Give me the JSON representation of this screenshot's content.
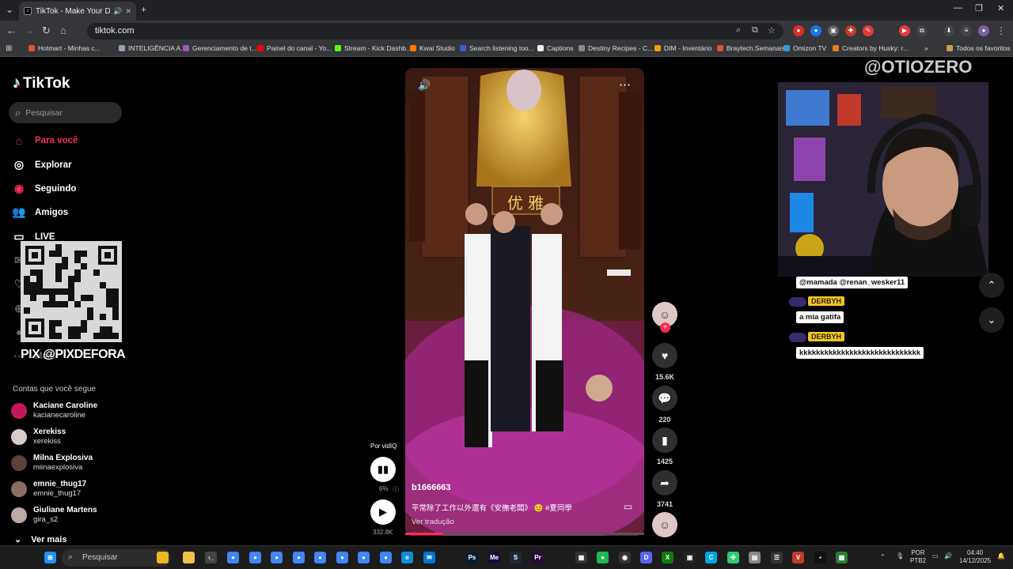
{
  "browser": {
    "tab_title": "TikTok - Make Your Day",
    "url": "tiktok.com",
    "bookmarks": [
      {
        "label": "Hotmart - Minhas c...",
        "color": "#e74c3c"
      },
      {
        "label": "INTELIGÊNCIA A...",
        "color": "#9aa0a6"
      },
      {
        "label": "Gerenciamento de t...",
        "color": "#9b59b6"
      },
      {
        "label": "Painel do canal - Yo...",
        "color": "#ff0000"
      },
      {
        "label": "Stream - Kick Dashb...",
        "color": "#53fc18"
      },
      {
        "label": "Kwai Studio",
        "color": "#ff7a00"
      },
      {
        "label": "Search listening too...",
        "color": "#3b5bdb"
      },
      {
        "label": "Captions",
        "color": "#eeeeee"
      },
      {
        "label": "Destiny Recipes - C...",
        "color": "#888888"
      },
      {
        "label": "DIM - Inventário",
        "color": "#f39c12"
      },
      {
        "label": "Braytech.Semanais",
        "color": "#e74c3c"
      },
      {
        "label": "Omizon TV",
        "color": "#3498db"
      },
      {
        "label": "Creators by Husky: r...",
        "color": "#e67e22"
      }
    ],
    "all_favorites": "Todos os favoritos"
  },
  "tiktok": {
    "logo": "TikTok",
    "search_placeholder": "Pesquisar",
    "nav": [
      {
        "label": "Para você",
        "icon": "home-icon"
      },
      {
        "label": "Explorar",
        "icon": "compass-icon"
      },
      {
        "label": "Seguindo",
        "icon": "following-icon"
      },
      {
        "label": "Amigos",
        "icon": "friends-icon"
      },
      {
        "label": "LIVE",
        "icon": "live-icon"
      },
      {
        "label": "Mensagens",
        "icon": "messages-icon"
      },
      {
        "label": "Atividade",
        "icon": "activity-icon"
      },
      {
        "label": "Carregar",
        "icon": "upload-icon"
      },
      {
        "label": "Perfil",
        "icon": "profile-icon"
      },
      {
        "label": "Mais",
        "icon": "more-icon"
      }
    ],
    "overlay_pix": "PIX @PIXDEFORA",
    "following_title": "Contas que você segue",
    "following": [
      {
        "name": "Kaciane Caroline",
        "username": "kacianecaroline",
        "color": "#c2185b"
      },
      {
        "name": "Xerekiss",
        "username": "xerekiss",
        "color": "#d7ccc8"
      },
      {
        "name": "Milna Explosiva",
        "username": "miinaexplosiva",
        "color": "#5d4037"
      },
      {
        "name": "emnie_thug17",
        "username": "emnie_thug17",
        "color": "#8d6e63"
      },
      {
        "name": "Giuliane Martens",
        "username": "gira_s2",
        "color": "#bcaaa4"
      }
    ],
    "ver_mais": "Ver mais",
    "video": {
      "author": "b1666663",
      "description": "平常除了工作以外還有《安撫老闆》 😊 #夏同學",
      "translate": "Ver tradução",
      "progress": 0.16
    },
    "actions": {
      "likes": "15.6K",
      "comments": "220",
      "saves": "1425",
      "shares": "3741"
    },
    "left_controls": {
      "by": "Por vidIQ",
      "percent": "6%",
      "views": "332.8K"
    }
  },
  "stream_overlay": {
    "handle": "@OTIOZERO",
    "chat": [
      {
        "user": "",
        "text": "@mamada @renan_wesker11"
      },
      {
        "user": "DERBYH",
        "text": "a mia gatifa"
      },
      {
        "user": "DERBYH",
        "text": "kkkkkkkkkkkkkkkkkkkkkkkkkkkkk"
      }
    ]
  },
  "taskbar": {
    "search": "Pesquisar",
    "lang_top": "POR",
    "lang_bottom": "PTB2",
    "time": "04:40",
    "date": "14/12/2025"
  }
}
